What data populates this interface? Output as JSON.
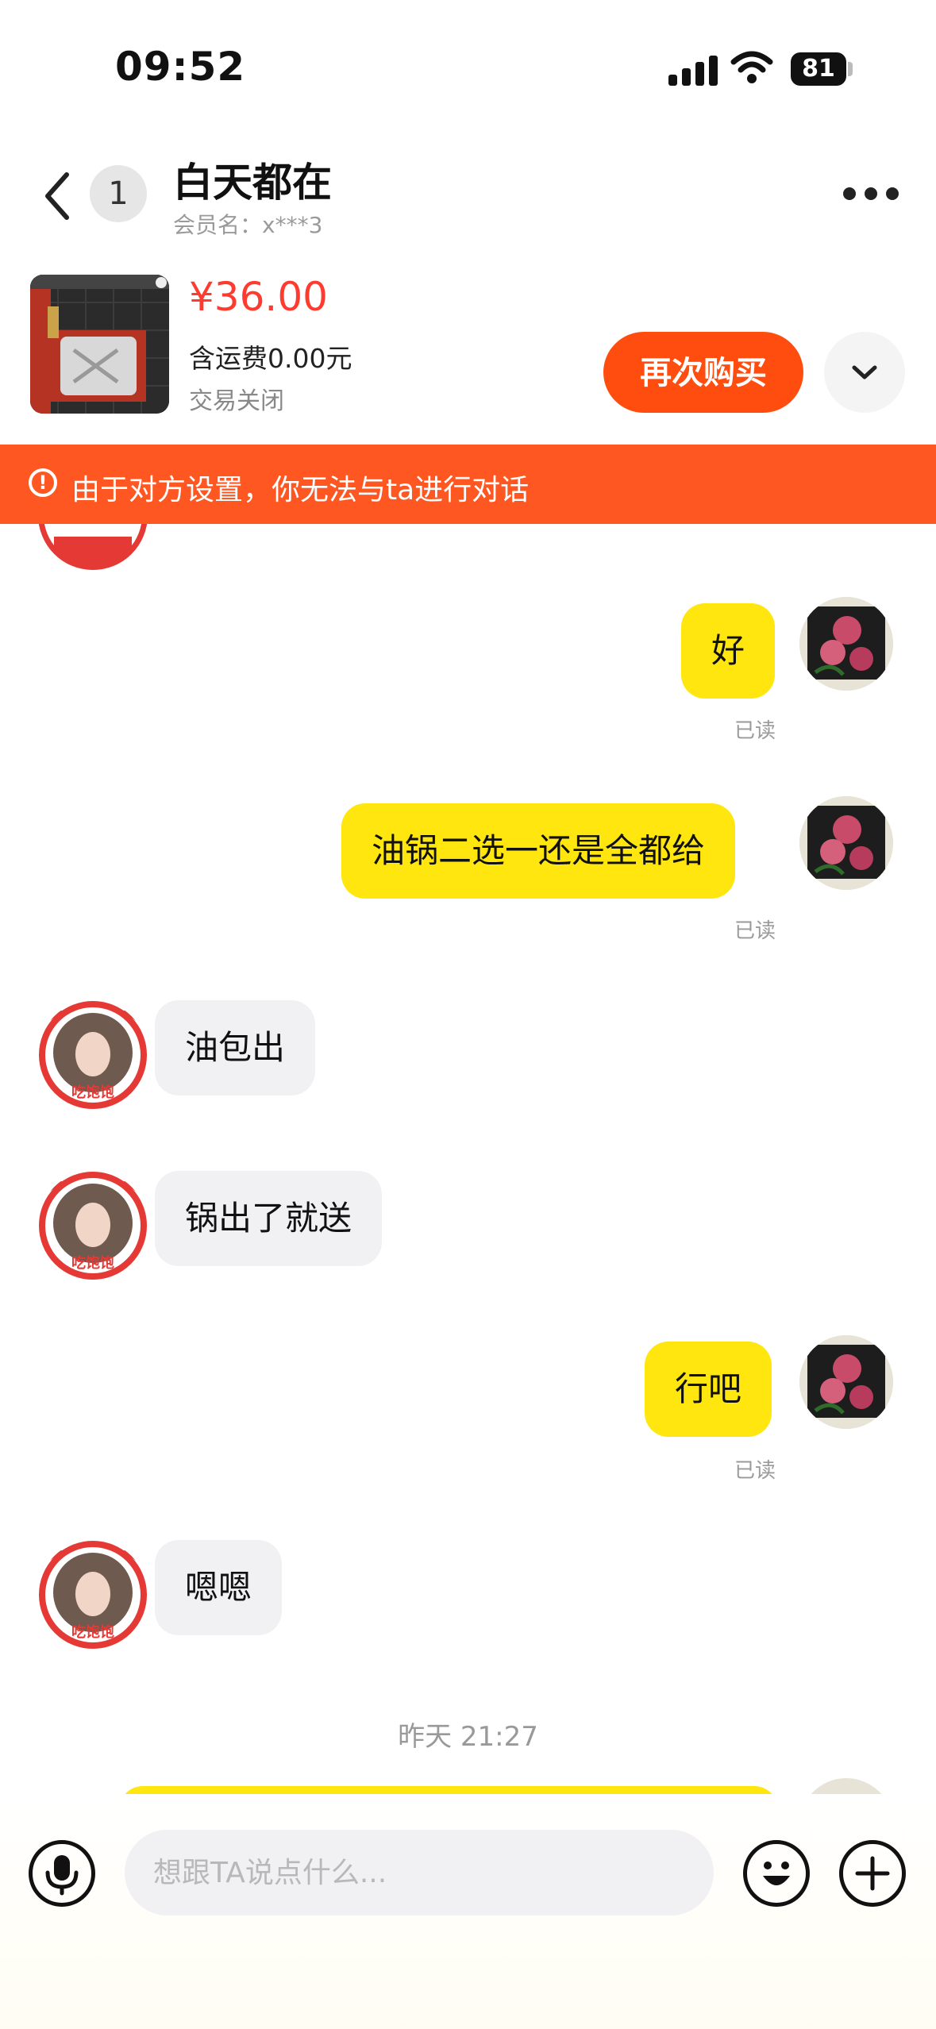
{
  "status_bar": {
    "time": "09:52",
    "battery": "81"
  },
  "header": {
    "title": "白天都在",
    "member_name": "会员名：x***3",
    "unread_count": "1"
  },
  "product": {
    "price": "¥36.00",
    "shipping": "含运费0.00元",
    "status": "交易关闭",
    "rebuy_label": "再次购买"
  },
  "warning": {
    "text": "由于对方设置，你无法与ta进行对话"
  },
  "messages": [
    {
      "side": "me",
      "text": "好",
      "read": "已读"
    },
    {
      "side": "me",
      "text": "油锅二选一还是全都给",
      "read": "已读"
    },
    {
      "side": "other",
      "text": "油包出"
    },
    {
      "side": "other",
      "text": "锅出了就送"
    },
    {
      "side": "me",
      "text": "行吧",
      "read": "已读"
    },
    {
      "side": "other",
      "text": "嗯嗯"
    }
  ],
  "time_divider": "昨天 21:27",
  "input": {
    "placeholder": "想跟TA说点什么..."
  },
  "avatar_badge": "吃饱饱没烦恼",
  "colors": {
    "accent": "#ff4d0f",
    "warning": "#ff5722",
    "my_bubble": "#ffe60f",
    "other_bubble": "#f1f1f3",
    "price": "#ff3b30"
  }
}
